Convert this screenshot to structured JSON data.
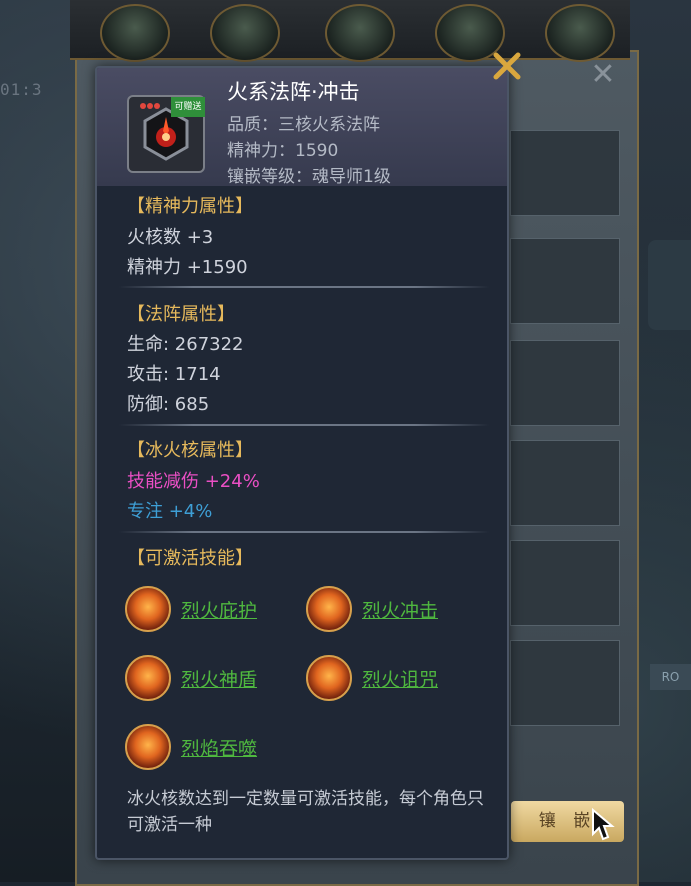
{
  "background": {
    "timer": "01:3",
    "inlay_button": "镶 嵌",
    "right_tag": "RO"
  },
  "item": {
    "badge": "可赠送",
    "title": "火系法阵·冲击",
    "quality": "品质：三核火系法阵",
    "spirit": "精神力：1590",
    "inlay_level": "镶嵌等级：魂导师1级"
  },
  "spirit_section": {
    "title": "【精神力属性】",
    "stats": [
      "火核数 +3",
      "精神力 +1590"
    ]
  },
  "array_section": {
    "title": "【法阵属性】",
    "stats": [
      "生命: 267322",
      "攻击: 1714",
      "防御: 685"
    ]
  },
  "core_section": {
    "title": "【冰火核属性】",
    "stats": [
      "技能减伤 +24%",
      "专注 +4%"
    ]
  },
  "skills_section": {
    "title": "【可激活技能】",
    "skills": [
      "烈火庇护",
      "烈火冲击",
      "烈火神盾",
      "烈火诅咒",
      "烈焰吞噬"
    ]
  },
  "description": "冰火核数达到一定数量可激活技能，每个角色只可激活一种",
  "colors": {
    "section_title": "#e6b95c",
    "skill_link": "#4fb83f",
    "damage_reduction": "#ea4fc4",
    "focus": "#3e9fd6"
  },
  "icons": {
    "close": "x-close-icon",
    "cursor": "mouse-pointer-icon"
  }
}
